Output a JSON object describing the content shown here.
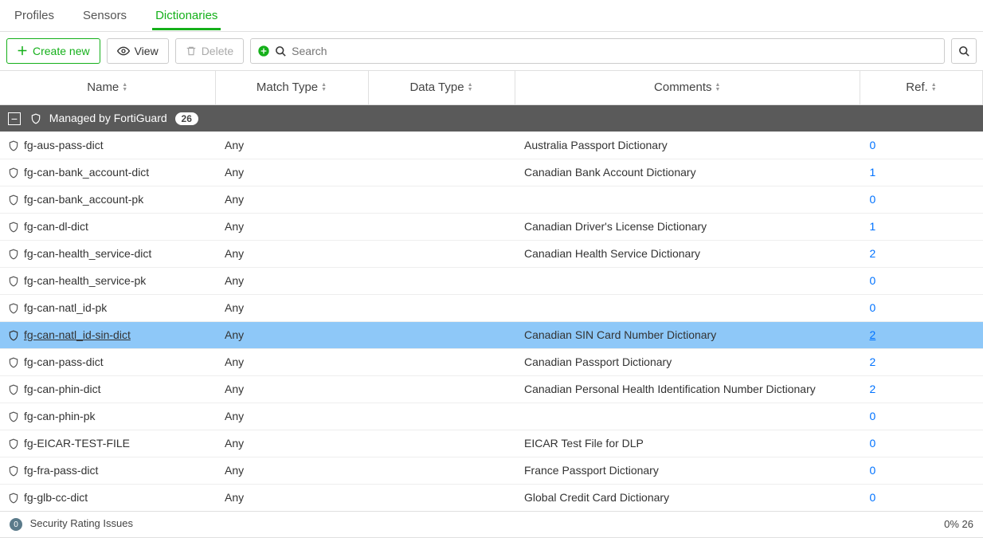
{
  "tabs": {
    "profiles": "Profiles",
    "sensors": "Sensors",
    "dictionaries": "Dictionaries"
  },
  "toolbar": {
    "create": "Create new",
    "view": "View",
    "delete": "Delete",
    "search_placeholder": "Search"
  },
  "columns": {
    "name": "Name",
    "match": "Match Type",
    "data": "Data Type",
    "comments": "Comments",
    "ref": "Ref."
  },
  "group": {
    "label": "Managed by FortiGuard",
    "count": "26"
  },
  "rows": [
    {
      "name": "fg-aus-pass-dict",
      "match": "Any",
      "data": "",
      "comments": "Australia Passport Dictionary",
      "ref": "0",
      "selected": false
    },
    {
      "name": "fg-can-bank_account-dict",
      "match": "Any",
      "data": "",
      "comments": "Canadian Bank Account Dictionary",
      "ref": "1",
      "selected": false
    },
    {
      "name": "fg-can-bank_account-pk",
      "match": "Any",
      "data": "",
      "comments": "",
      "ref": "0",
      "selected": false
    },
    {
      "name": "fg-can-dl-dict",
      "match": "Any",
      "data": "",
      "comments": "Canadian Driver's License Dictionary",
      "ref": "1",
      "selected": false
    },
    {
      "name": "fg-can-health_service-dict",
      "match": "Any",
      "data": "",
      "comments": "Canadian Health Service Dictionary",
      "ref": "2",
      "selected": false
    },
    {
      "name": "fg-can-health_service-pk",
      "match": "Any",
      "data": "",
      "comments": "",
      "ref": "0",
      "selected": false
    },
    {
      "name": "fg-can-natl_id-pk",
      "match": "Any",
      "data": "",
      "comments": "",
      "ref": "0",
      "selected": false
    },
    {
      "name": "fg-can-natl_id-sin-dict",
      "match": "Any",
      "data": "",
      "comments": "Canadian SIN Card Number Dictionary",
      "ref": "2",
      "selected": true
    },
    {
      "name": "fg-can-pass-dict",
      "match": "Any",
      "data": "",
      "comments": "Canadian Passport Dictionary",
      "ref": "2",
      "selected": false
    },
    {
      "name": "fg-can-phin-dict",
      "match": "Any",
      "data": "",
      "comments": "Canadian Personal Health Identification Number Dictionary",
      "ref": "2",
      "selected": false
    },
    {
      "name": "fg-can-phin-pk",
      "match": "Any",
      "data": "",
      "comments": "",
      "ref": "0",
      "selected": false
    },
    {
      "name": "fg-EICAR-TEST-FILE",
      "match": "Any",
      "data": "",
      "comments": "EICAR Test File for DLP",
      "ref": "0",
      "selected": false
    },
    {
      "name": "fg-fra-pass-dict",
      "match": "Any",
      "data": "",
      "comments": "France Passport Dictionary",
      "ref": "0",
      "selected": false
    },
    {
      "name": "fg-glb-cc-dict",
      "match": "Any",
      "data": "",
      "comments": "Global Credit Card Dictionary",
      "ref": "0",
      "selected": false
    }
  ],
  "footer": {
    "issues": "Security Rating Issues",
    "pct": "0% 26"
  }
}
